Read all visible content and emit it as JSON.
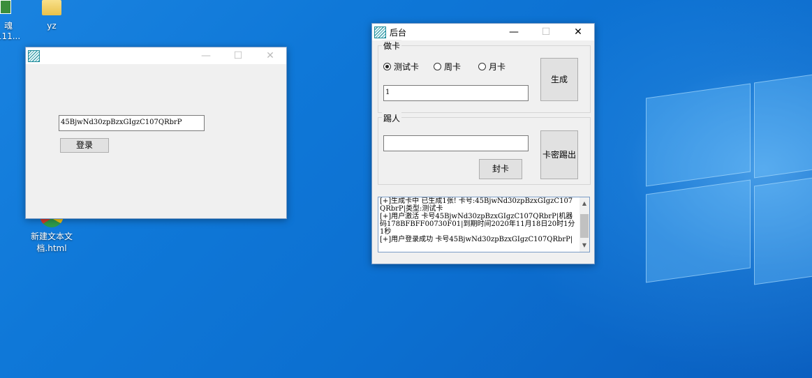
{
  "desktop": {
    "icons": [
      {
        "label_line1": "魂",
        "label_line2": "111..."
      },
      {
        "label": "yz"
      },
      {
        "label_line1": "新建文本文",
        "label_line2": "档.html"
      }
    ]
  },
  "login_window": {
    "title": "",
    "card_value": "45BjwNd30zpBzxGIgzC107QRbrP",
    "login_button": "登录",
    "controls": {
      "minimize": "—",
      "maximize": "☐",
      "close": "✕"
    }
  },
  "admin_window": {
    "title": "后台",
    "controls": {
      "minimize": "—",
      "maximize": "☐",
      "close": "✕"
    },
    "make_card": {
      "group_label": "做卡",
      "radios": [
        {
          "label": "测试卡",
          "selected": true
        },
        {
          "label": "周卡",
          "selected": false
        },
        {
          "label": "月卡",
          "selected": false
        }
      ],
      "quantity_value": "1",
      "generate_button": "生成"
    },
    "kick": {
      "group_label": "踢人",
      "card_input_value": "",
      "ban_button": "封卡",
      "kick_button": "卡密踢出"
    },
    "log_lines": [
      "[+]生成卡中 已生成1张! 卡号:45BjwNd30zpBzxGIgzC107QRbrP|类型:测试卡",
      "[+]用户激活 卡号45BjwNd30zpBzxGIgzC107QRbrP|机器码178BFBFF00730F01|到期时间2020年11月18日20时1分1秒",
      "[+]用户登录成功 卡号45BjwNd30zpBzxGIgzC107QRbrP|"
    ],
    "scroll_up": "▲",
    "scroll_down": "▼"
  }
}
